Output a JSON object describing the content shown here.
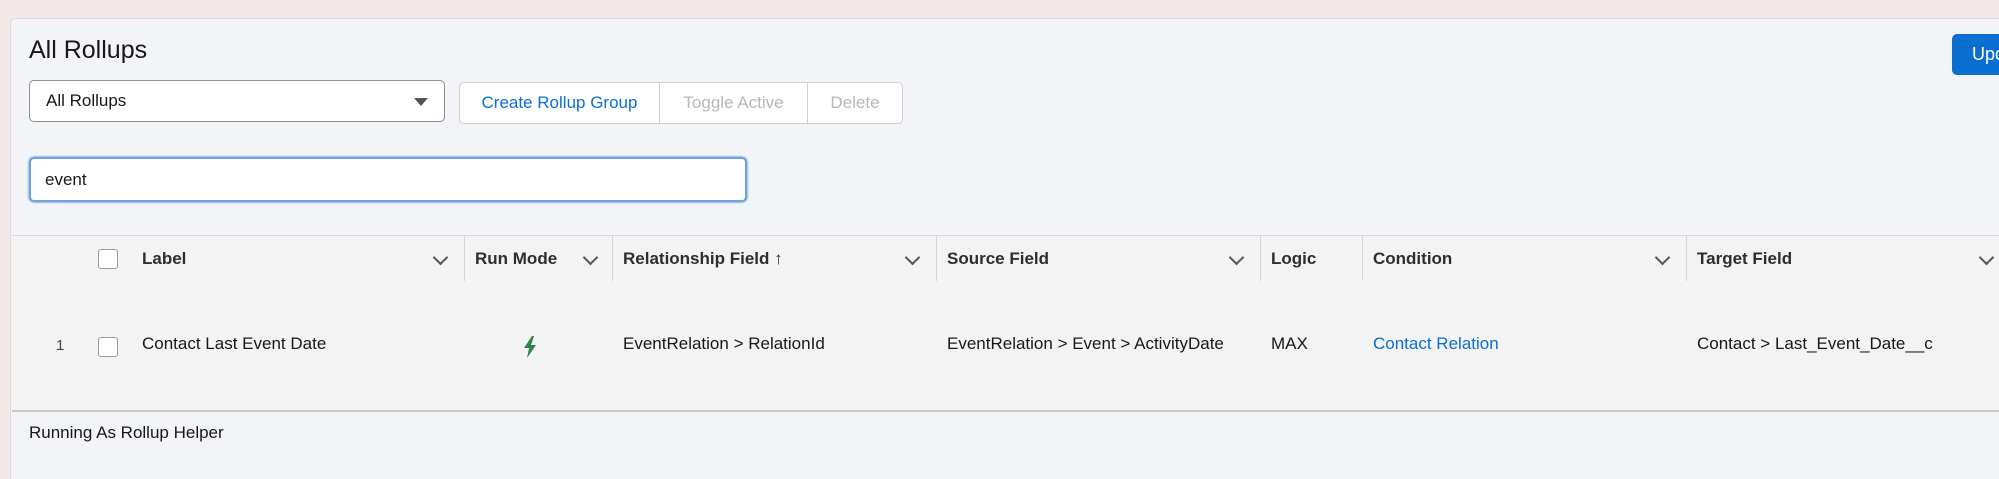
{
  "header": {
    "title": "All Rollups",
    "update_label": "Upd"
  },
  "filter": {
    "selected": "All Rollups"
  },
  "actions": {
    "create": "Create Rollup Group",
    "toggle": "Toggle Active",
    "delete": "Delete"
  },
  "search": {
    "value": "event"
  },
  "table": {
    "columns": [
      "Label",
      "Run Mode",
      "Relationship Field ↑",
      "Source Field",
      "Logic",
      "Condition",
      "Target Field"
    ],
    "rows": [
      {
        "num": "1",
        "label": "Contact Last Event Date",
        "run_mode_icon": "lightning-bolt-icon",
        "relationship": "EventRelation > RelationId",
        "source": "EventRelation > Event > ActivityDate",
        "logic": "MAX",
        "condition": "Contact Relation",
        "target": "Contact > Last_Event_Date__c"
      }
    ]
  },
  "footer": {
    "text": "Running As Rollup Helper"
  },
  "colors": {
    "accent": "#0b6ed1",
    "bolt": "#2e844a"
  }
}
